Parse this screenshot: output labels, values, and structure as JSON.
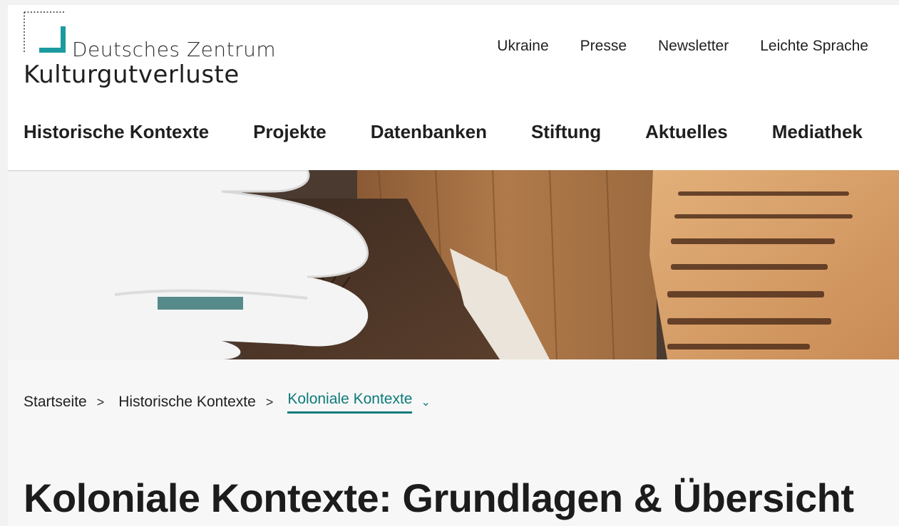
{
  "logo": {
    "line1": "Deutsches Zentrum",
    "line2": "Kulturgutverluste"
  },
  "meta_nav": [
    "Ukraine",
    "Presse",
    "Newsletter",
    "Leichte Sprache"
  ],
  "main_nav": [
    "Historische Kontexte",
    "Projekte",
    "Datenbanken",
    "Stiftung",
    "Aktuelles",
    "Mediathek"
  ],
  "breadcrumb": {
    "items": [
      "Startseite",
      "Historische Kontexte"
    ],
    "current": "Koloniale Kontexte",
    "separator": ">",
    "dropdown_icon": "chevron-down-icon"
  },
  "page_title": "Koloniale Kontexte: Grundlagen & Übersicht",
  "colors": {
    "accent": "#0f7a7a",
    "logo_teal": "#1c9aa0",
    "text": "#1c1c1c",
    "page_background": "#f7f7f7"
  }
}
